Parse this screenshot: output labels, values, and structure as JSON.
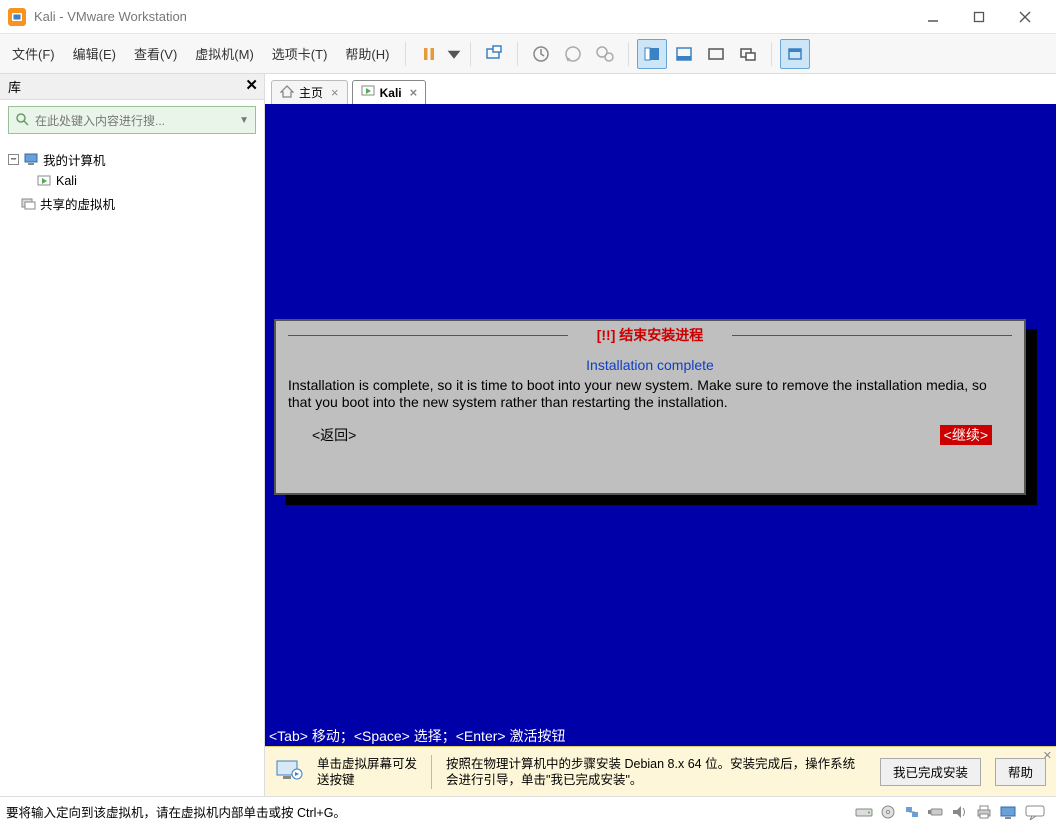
{
  "window": {
    "title": "Kali - VMware Workstation"
  },
  "menu": {
    "file": "文件(F)",
    "edit": "编辑(E)",
    "view": "查看(V)",
    "vm": "虚拟机(M)",
    "tabs": "选项卡(T)",
    "help": "帮助(H)"
  },
  "sidebar": {
    "title": "库",
    "search_placeholder": "在此处键入内容进行搜...",
    "nodes": {
      "my_computer": "我的计算机",
      "kali": "Kali",
      "shared": "共享的虚拟机"
    }
  },
  "tabs": {
    "home": "主页",
    "kali": "Kali"
  },
  "installer": {
    "title": "[!!] 结束安装进程",
    "subtitle": "Installation complete",
    "body": "Installation is complete, so it is time to boot into your new system. Make sure to remove the installation media, so that you boot into the new system rather than restarting the installation.",
    "back": "<返回>",
    "continue": "<继续>"
  },
  "vm_footer": "<Tab> 移动；<Space> 选择；<Enter> 激活按钮",
  "info": {
    "hint1": "单击虚拟屏幕可发送按键",
    "hint2": "按照在物理计算机中的步骤安装 Debian 8.x 64 位。安装完成后，操作系统会进行引导，单击\"我已完成安装\"。",
    "done": "我已完成安装",
    "help": "帮助"
  },
  "status": {
    "text": "要将输入定向到该虚拟机，请在虚拟机内部单击或按 Ctrl+G。"
  }
}
